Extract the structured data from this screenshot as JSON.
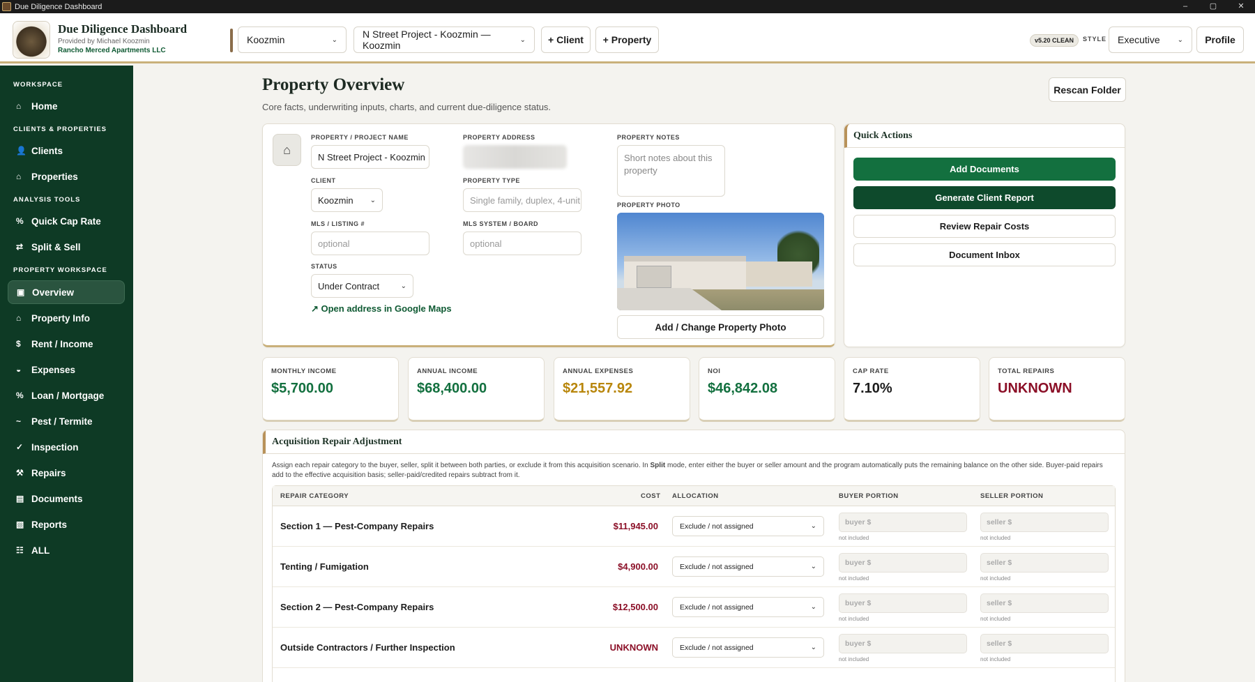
{
  "window": {
    "title": "Due Diligence Dashboard",
    "controls": [
      "–",
      "▢",
      "✕"
    ]
  },
  "header": {
    "brand_title": "Due Diligence Dashboard",
    "brand_sub": "Provided by Michael Koozmin",
    "brand_company": "Rancho Merced Apartments LLC",
    "client_select": "Koozmin",
    "property_select": "N Street Project - Koozmin — Koozmin",
    "add_client": "+ Client",
    "add_property": "+ Property",
    "version_badge": "v5.20 CLEAN",
    "style_label": "STYLE",
    "style_select": "Executive",
    "profile": "Profile"
  },
  "sidebar": {
    "sections": [
      "WORKSPACE",
      "CLIENTS & PROPERTIES",
      "ANALYSIS TOOLS",
      "PROPERTY WORKSPACE"
    ],
    "items": [
      {
        "label": "Home",
        "icon": "⌂"
      },
      {
        "label": "Clients",
        "icon": "👤"
      },
      {
        "label": "Properties",
        "icon": "⌂"
      },
      {
        "label": "Quick Cap Rate",
        "icon": "%"
      },
      {
        "label": "Split & Sell",
        "icon": "⇄"
      },
      {
        "label": "Overview",
        "icon": "▣"
      },
      {
        "label": "Property Info",
        "icon": "⌂"
      },
      {
        "label": "Rent / Income",
        "icon": "$"
      },
      {
        "label": "Expenses",
        "icon": "◒"
      },
      {
        "label": "Loan / Mortgage",
        "icon": "%"
      },
      {
        "label": "Pest / Termite",
        "icon": "~"
      },
      {
        "label": "Inspection",
        "icon": "✓"
      },
      {
        "label": "Repairs",
        "icon": "⚒"
      },
      {
        "label": "Documents",
        "icon": "▤"
      },
      {
        "label": "Reports",
        "icon": "▧"
      },
      {
        "label": "ALL",
        "icon": "☷"
      }
    ]
  },
  "page": {
    "title": "Property Overview",
    "subtitle": "Core facts, underwriting inputs, charts, and current due-diligence status.",
    "rescan": "Rescan Folder"
  },
  "info": {
    "name_label": "PROPERTY / PROJECT NAME",
    "name_value": "N Street Project - Koozmin",
    "address_label": "PROPERTY ADDRESS",
    "notes_label": "PROPERTY NOTES",
    "notes_placeholder": "Short notes about this property",
    "client_label": "CLIENT",
    "client_value": "Koozmin",
    "type_label": "PROPERTY TYPE",
    "type_placeholder": "Single family, duplex, 4-unit…",
    "mls_label": "MLS / LISTING #",
    "mls_placeholder": "optional",
    "mls_sys_label": "MLS SYSTEM / BOARD",
    "mls_sys_placeholder": "optional",
    "status_label": "STATUS",
    "status_value": "Under Contract",
    "photo_label": "PROPERTY PHOTO",
    "maps_link": "↗ Open address in Google Maps",
    "change_photo": "Add / Change Property Photo"
  },
  "quick_actions": {
    "title": "Quick Actions",
    "buttons": [
      "Add Documents",
      "Generate Client Report",
      "Review Repair Costs",
      "Document Inbox"
    ]
  },
  "kpis": [
    {
      "label": "MONTHLY INCOME",
      "value": "$5,700.00",
      "color": "#13703f"
    },
    {
      "label": "ANNUAL INCOME",
      "value": "$68,400.00",
      "color": "#13703f"
    },
    {
      "label": "ANNUAL EXPENSES",
      "value": "$21,557.92",
      "color": "#b8860b"
    },
    {
      "label": "NOI",
      "value": "$46,842.08",
      "color": "#13703f"
    },
    {
      "label": "CAP RATE",
      "value": "7.10%",
      "color": "#1d1d1d"
    },
    {
      "label": "TOTAL REPAIRS",
      "value": "UNKNOWN",
      "color": "#8b0f27"
    }
  ],
  "repair": {
    "title": "Acquisition Repair Adjustment",
    "desc_a": "Assign each repair category to the buyer, seller, split it between both parties, or exclude it from this acquisition scenario. In ",
    "desc_b": "Split",
    "desc_c": " mode, enter either the buyer or seller amount and the program automatically puts the remaining balance on the other side. Buyer-paid repairs add to the effective acquisition basis; seller-paid/credited repairs subtract from it.",
    "headers": {
      "category": "REPAIR CATEGORY",
      "cost": "COST",
      "allocation": "ALLOCATION",
      "buyer": "BUYER PORTION",
      "seller": "SELLER PORTION"
    },
    "rows": [
      {
        "category": "Section 1 — Pest-Company Repairs",
        "cost": "$11,945.00",
        "allocation": "Exclude / not assigned",
        "buyer": "buyer $",
        "seller": "seller $",
        "buyer_note": "not included",
        "seller_note": "not included"
      },
      {
        "category": "Tenting / Fumigation",
        "cost": "$4,900.00",
        "allocation": "Exclude / not assigned",
        "buyer": "buyer $",
        "seller": "seller $",
        "buyer_note": "not included",
        "seller_note": "not included"
      },
      {
        "category": "Section 2 — Pest-Company Repairs",
        "cost": "$12,500.00",
        "allocation": "Exclude / not assigned",
        "buyer": "buyer $",
        "seller": "seller $",
        "buyer_note": "not included",
        "seller_note": "not included"
      },
      {
        "category": "Outside Contractors / Further Inspection",
        "cost": "UNKNOWN",
        "allocation": "Exclude / not assigned",
        "buyer": "buyer $",
        "seller": "seller $",
        "buyer_note": "not included",
        "seller_note": "not included"
      }
    ]
  }
}
